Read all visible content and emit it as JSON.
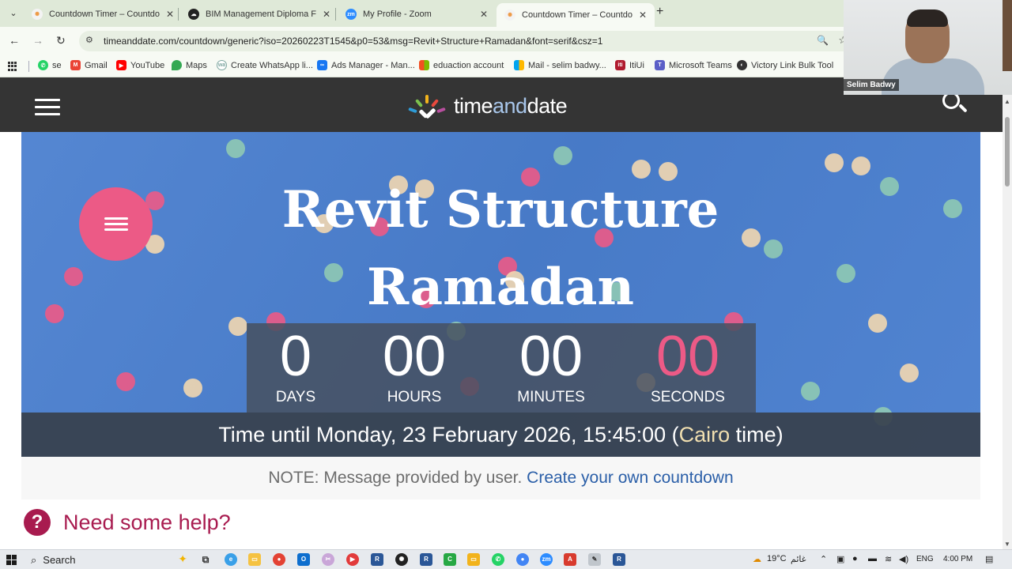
{
  "tabs": [
    {
      "title": "Countdown Timer – Countdown",
      "active": false,
      "favicon": "timeanddate-icon"
    },
    {
      "title": "BIM Management Diploma For",
      "active": false,
      "favicon": "cloud-icon"
    },
    {
      "title": "My Profile - Zoom",
      "active": false,
      "favicon": "zoom-icon"
    },
    {
      "title": "Countdown Timer – Countdown",
      "active": true,
      "favicon": "timeanddate-icon"
    }
  ],
  "address": {
    "url": "timeanddate.com/countdown/generic?iso=20260223T1545&p0=53&msg=Revit+Structure+Ramadan&font=serif&csz=1"
  },
  "bookmarks": [
    {
      "label": "se",
      "icon": "whatsapp-icon",
      "color": "#25d366"
    },
    {
      "label": "Gmail",
      "icon": "gmail-icon",
      "color": "#ea4335"
    },
    {
      "label": "YouTube",
      "icon": "youtube-icon",
      "color": "#ff0000"
    },
    {
      "label": "Maps",
      "icon": "maps-icon",
      "color": "#34a853"
    },
    {
      "label": "Create WhatsApp li...",
      "icon": "link-icon",
      "color": "#7fa7a0"
    },
    {
      "label": "Ads Manager - Man...",
      "icon": "meta-icon",
      "color": "#1877f2"
    },
    {
      "label": "eduaction account",
      "icon": "microsoft-icon",
      "color": "#f25022"
    },
    {
      "label": "Mail - selim badwy...",
      "icon": "microsoft-icon",
      "color": "#f25022"
    },
    {
      "label": "ItiUi",
      "icon": "iti-icon",
      "color": "#b01b2e"
    },
    {
      "label": "Microsoft Teams",
      "icon": "teams-icon",
      "color": "#5b5fc7"
    },
    {
      "label": "Victory Link Bulk Tool",
      "icon": "globe-icon",
      "color": "#333333"
    }
  ],
  "zoom": {
    "participant_name": "Selim Badwy"
  },
  "site": {
    "logo_plain_1": "time",
    "logo_accent": "and",
    "logo_plain_2": "date"
  },
  "countdown": {
    "title_line1": "Revit Structure",
    "title_line2": "Ramadan",
    "days": "0",
    "days_label": "DAYS",
    "hours": "00",
    "hours_label": "HOURS",
    "minutes": "00",
    "minutes_label": "MINUTES",
    "seconds": "00",
    "seconds_label": "SECONDS",
    "footer_prefix": "Time until Monday, 23 February 2026, 15:45:00 (",
    "footer_city": "Cairo",
    "footer_suffix": " time)"
  },
  "note": {
    "text": "NOTE: Message provided by user.",
    "link": "Create your own countdown"
  },
  "help": {
    "text": "Need some help?"
  },
  "taskbar": {
    "search_label": "Search",
    "weather": "19°C",
    "weather_desc": "غائم",
    "language": "ENG",
    "time": "4:00 PM"
  },
  "colors": {
    "banner": "#4a7fcf",
    "accent_pink": "#ec5a86",
    "header_dark": "#343434",
    "help_maroon": "#a81b4f",
    "link_blue": "#2b5fa8"
  }
}
